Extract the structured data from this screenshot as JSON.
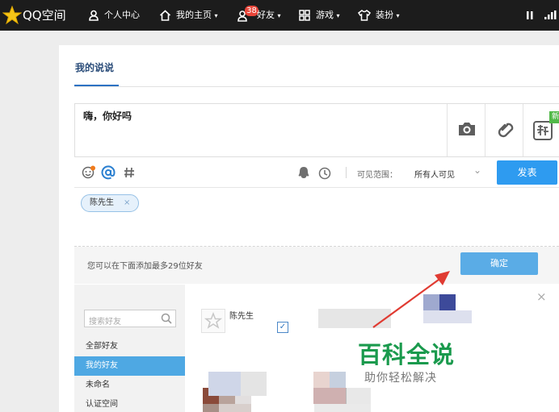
{
  "topbar": {
    "logo_text": "QQ空间",
    "nav": [
      {
        "label": "个人中心",
        "icon": "user-icon"
      },
      {
        "label": "我的主页",
        "icon": "home-icon"
      },
      {
        "label": "好友",
        "icon": "friends-icon",
        "badge": "38"
      },
      {
        "label": "游戏",
        "icon": "grid-icon"
      },
      {
        "label": "装扮",
        "icon": "shirt-icon"
      }
    ],
    "caret": "▾"
  },
  "tab": {
    "title": "我的说说"
  },
  "composer": {
    "text": "嗨，你好吗",
    "new_badge": "新"
  },
  "toolbar": {
    "visibility_label": "可见范围：",
    "visibility_value": "所有人可见",
    "visibility_caret": "⌄",
    "post_label": "发表"
  },
  "mention": {
    "chip_label": "陈先生",
    "chip_remove": "×"
  },
  "friend_picker": {
    "hint": "您可以在下面添加最多29位好友",
    "ok_label": "确定",
    "search_placeholder": "搜索好友",
    "groups": [
      "全部好友",
      "我的好友",
      "未命名",
      "认证空间"
    ],
    "active_group": "我的好友",
    "close_label": "×",
    "friend_name": "陈先生",
    "friend_checked": "✓"
  },
  "watermark": {
    "title": "百科全说",
    "subtitle": "助你轻松解决"
  },
  "colors": {
    "accent": "#2e9bf0",
    "topbar": "#1c1c1c",
    "arrow": "#e03b32",
    "watermark": "#1a9a4d"
  }
}
